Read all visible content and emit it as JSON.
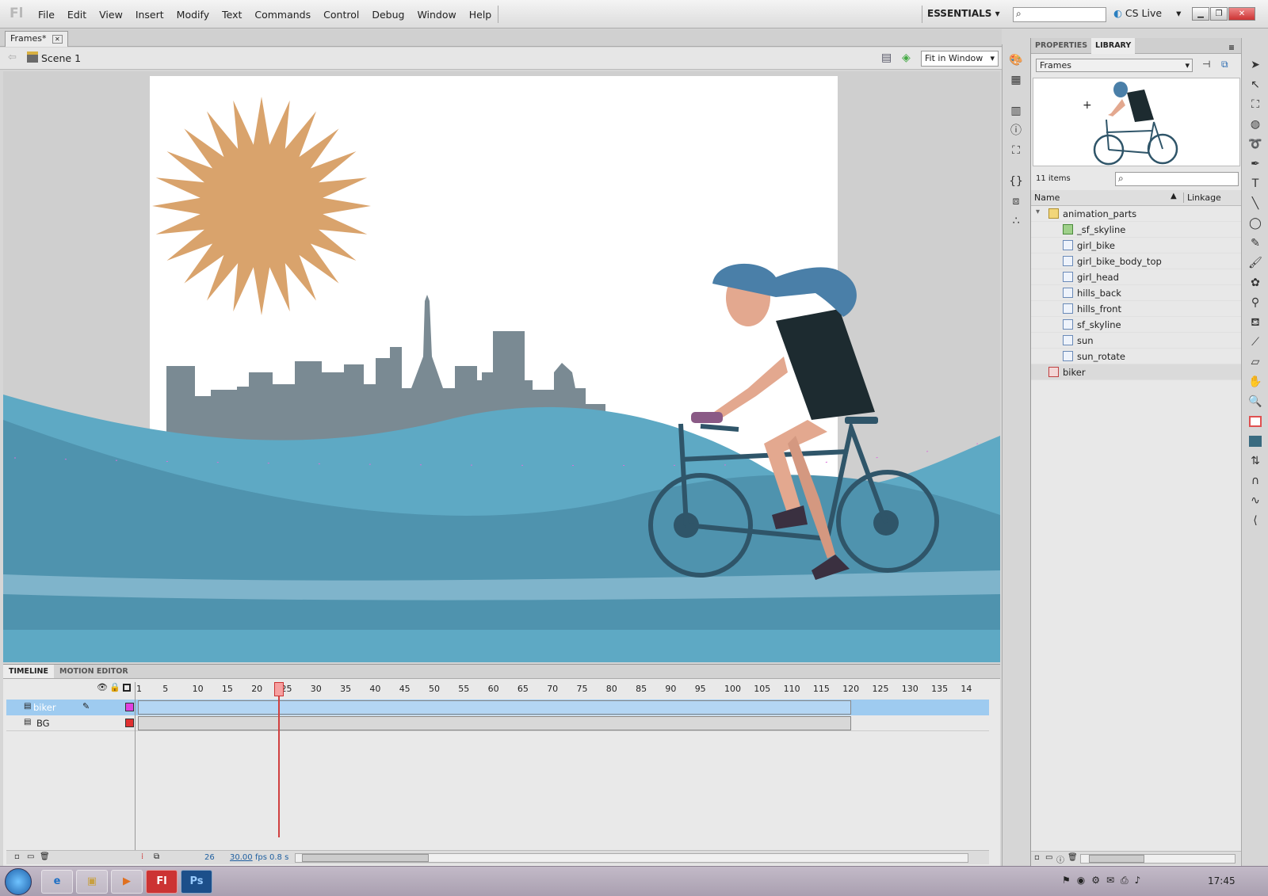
{
  "app": {
    "logo": "Fl"
  },
  "menu": [
    "File",
    "Edit",
    "View",
    "Insert",
    "Modify",
    "Text",
    "Commands",
    "Control",
    "Debug",
    "Window",
    "Help"
  ],
  "workspace": "ESSENTIALS",
  "cs_live": "CS Live",
  "document": {
    "tab": "Frames*",
    "scene": "Scene 1",
    "zoom": "Fit in Window"
  },
  "timeline": {
    "tabs": [
      "TIMELINE",
      "MOTION EDITOR"
    ],
    "frame_numbers": [
      "1",
      "5",
      "10",
      "15",
      "20",
      "25",
      "30",
      "35",
      "40",
      "45",
      "50",
      "55",
      "60",
      "65",
      "70",
      "75",
      "80",
      "85",
      "90",
      "95",
      "100",
      "105",
      "110",
      "115",
      "120",
      "125",
      "130",
      "135",
      "14"
    ],
    "current_frame": "26",
    "fps": "30.00",
    "fps_unit": "fps",
    "time": "0.8 s",
    "playhead_frame": 26,
    "last_frame": 120,
    "layers": [
      {
        "name": "biker",
        "color": "#e040e0",
        "selected": true
      },
      {
        "name": "BG",
        "color": "#e03030",
        "selected": false
      }
    ]
  },
  "library": {
    "tabs": [
      "PROPERTIES",
      "LIBRARY"
    ],
    "dropdown": "Frames",
    "item_count": "11 items",
    "col_name": "Name",
    "col_linkage": "Linkage",
    "items": [
      {
        "name": "animation_parts",
        "type": "folder"
      },
      {
        "name": "_sf_skyline",
        "type": "bitmap"
      },
      {
        "name": "girl_bike",
        "type": "symbol"
      },
      {
        "name": "girl_bike_body_top",
        "type": "symbol"
      },
      {
        "name": "girl_head",
        "type": "symbol"
      },
      {
        "name": "hills_back",
        "type": "symbol"
      },
      {
        "name": "hills_front",
        "type": "symbol"
      },
      {
        "name": "sf_skyline",
        "type": "symbol"
      },
      {
        "name": "sun",
        "type": "symbol"
      },
      {
        "name": "sun_rotate",
        "type": "symbol"
      },
      {
        "name": "biker",
        "type": "movie"
      }
    ]
  },
  "clock": "17:45",
  "colors": {
    "sun": "#d9a36c",
    "skyline": "#7a8a93",
    "hills_back": "#5ea9c4",
    "hills_front": "#4f93ae",
    "bike": "#2f5569",
    "stroke_color": "#e05050",
    "fill_color": "#3a6b80"
  }
}
